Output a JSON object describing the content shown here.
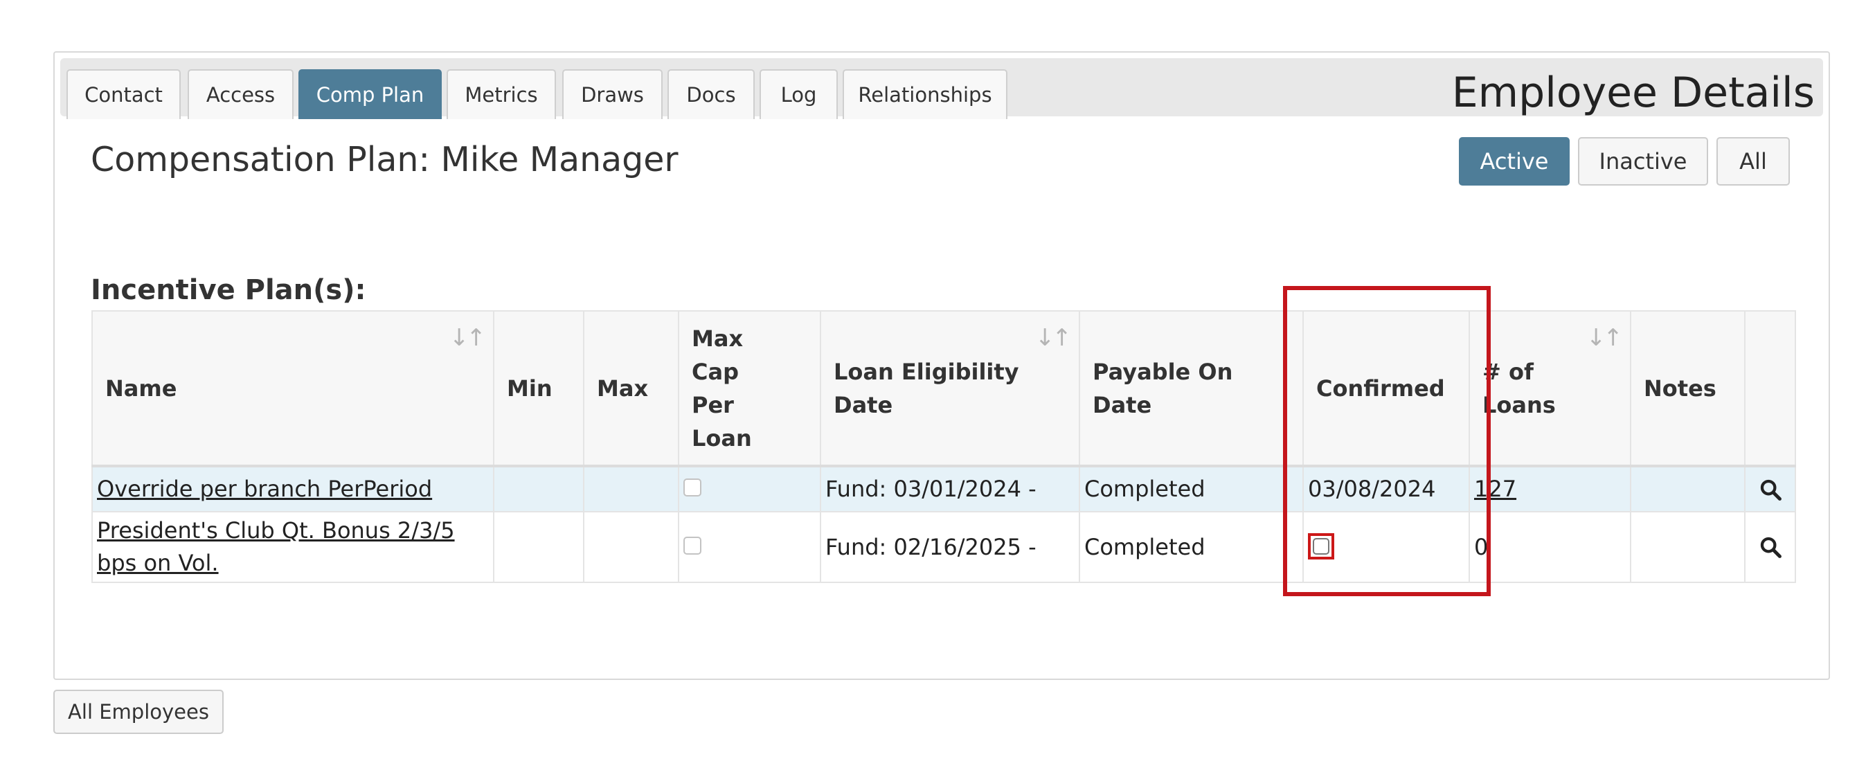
{
  "tabs": [
    {
      "label": "Contact"
    },
    {
      "label": "Access"
    },
    {
      "label": "Comp Plan"
    },
    {
      "label": "Metrics"
    },
    {
      "label": "Draws"
    },
    {
      "label": "Docs"
    },
    {
      "label": "Log"
    },
    {
      "label": "Relationships"
    }
  ],
  "header_title": "Employee Details",
  "plan_title": "Compensation Plan: Mike Manager",
  "filters": {
    "active": "Active",
    "inactive": "Inactive",
    "all": "All"
  },
  "section_title": "Incentive Plan(s):",
  "columns": {
    "name": "Name",
    "min": "Min",
    "max": "Max",
    "max_cap_1": "Max",
    "max_cap_2": "Cap",
    "max_cap_3": "Per",
    "max_cap_4": "Loan",
    "loan_elig_1": "Loan Eligibility",
    "loan_elig_2": "Date",
    "payable_1": "Payable On",
    "payable_2": "Date",
    "confirmed": "Confirmed",
    "loans_1": "# of",
    "loans_2": "Loans",
    "notes": "Notes"
  },
  "rows": [
    {
      "name": "Override per branch PerPeriod",
      "loan_eligibility": "Fund: 03/01/2024 -",
      "payable_on": "Completed",
      "confirmed": "03/08/2024",
      "loans": "127"
    },
    {
      "name": "President's Club Qt. Bonus 2/3/5 bps on Vol.",
      "loan_eligibility": "Fund: 02/16/2025 -",
      "payable_on": "Completed",
      "confirmed": "",
      "loans": "0"
    }
  ],
  "bottom_button": "All Employees",
  "colors": {
    "accent": "#4e7d98",
    "highlight": "#c4161c",
    "row_selected": "#e6f2f8"
  },
  "icons": {
    "sort": "sort-arrows-icon",
    "view": "magnifier-icon",
    "checkbox": "checkbox-icon"
  }
}
